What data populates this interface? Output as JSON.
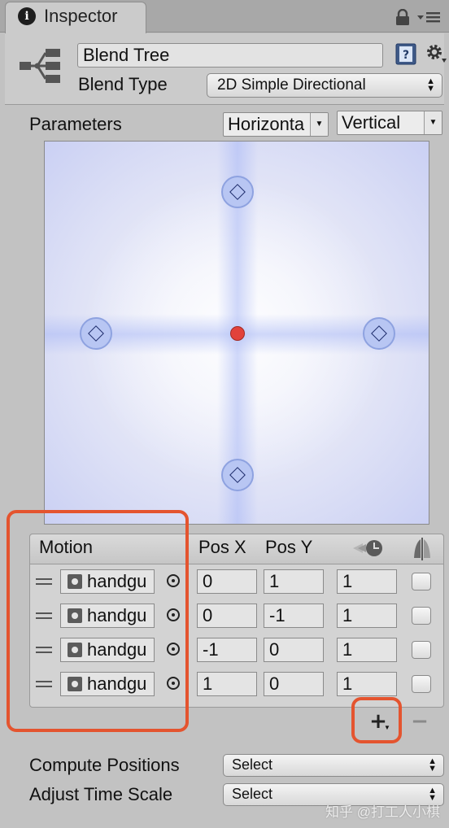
{
  "tab": {
    "title": "Inspector",
    "info_glyph": "i"
  },
  "header": {
    "name": "Blend Tree",
    "blend_type_label": "Blend Type",
    "blend_type_value": "2D Simple Directional"
  },
  "parameters": {
    "label": "Parameters",
    "x_param": "Horizonta",
    "y_param": "Vertical"
  },
  "graph": {
    "nodes": [
      {
        "x": 0,
        "y": 1
      },
      {
        "x": 0,
        "y": -1
      },
      {
        "x": -1,
        "y": 0
      },
      {
        "x": 1,
        "y": 0
      }
    ],
    "current": {
      "x": 0,
      "y": 0
    },
    "colors": {
      "node": "#b8c6f3",
      "current": "#e2423b",
      "background": "#dfe2f6"
    }
  },
  "table": {
    "headers": {
      "motion": "Motion",
      "pos_x": "Pos X",
      "pos_y": "Pos Y"
    },
    "rows": [
      {
        "clip": "handgu",
        "pos_x": "0",
        "pos_y": "1",
        "speed": "1"
      },
      {
        "clip": "handgu",
        "pos_x": "0",
        "pos_y": "-1",
        "speed": "1"
      },
      {
        "clip": "handgu",
        "pos_x": "-1",
        "pos_y": "0",
        "speed": "1"
      },
      {
        "clip": "handgu",
        "pos_x": "1",
        "pos_y": "0",
        "speed": "1"
      }
    ],
    "add_label": "+",
    "remove_label": "−"
  },
  "settings": {
    "compute_positions_label": "Compute Positions",
    "compute_positions_value": "Select",
    "adjust_time_scale_label": "Adjust Time Scale",
    "adjust_time_scale_value": "Select"
  },
  "watermark": "知乎 @打工人小棋",
  "annotation_color": "#e4542f"
}
